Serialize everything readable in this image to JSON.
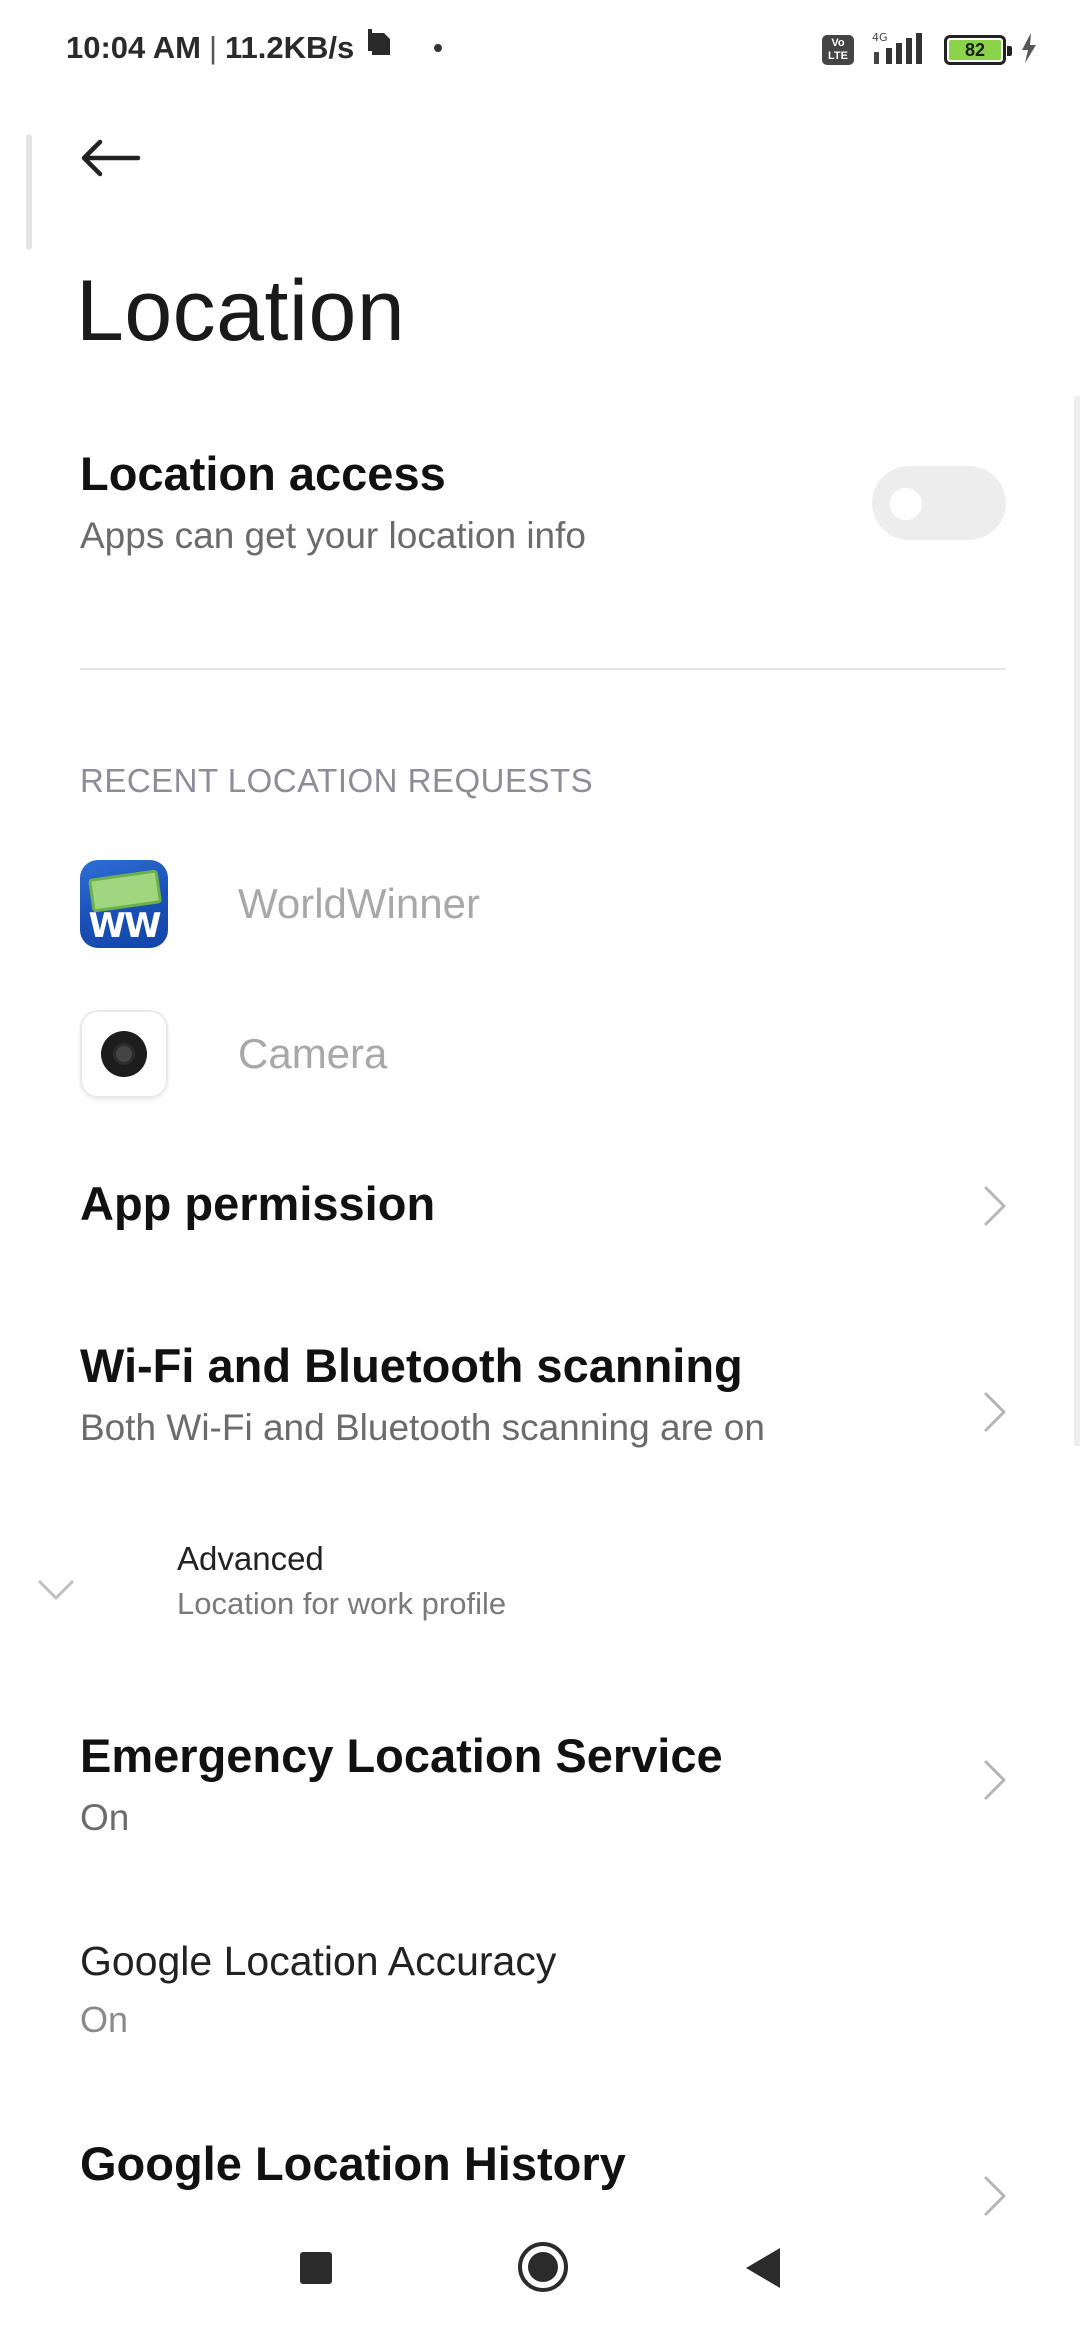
{
  "status_bar": {
    "time": "10:04 AM",
    "separator": "|",
    "network_speed": "11.2KB/s",
    "icons": [
      "sim-card-icon",
      "notification-dot-icon",
      "volte-icon",
      "signal-4g-icon",
      "battery-icon",
      "charging-icon"
    ],
    "volte_label": "Vo\nLTE",
    "network_type": "4G",
    "battery_level": "82",
    "battery_color": "#8bd34a"
  },
  "header": {
    "back_icon": "arrow-left-icon",
    "title": "Location"
  },
  "location_access": {
    "title": "Location access",
    "subtitle": "Apps can get your location info",
    "toggle_on": false
  },
  "recent_requests": {
    "header": "RECENT LOCATION REQUESTS",
    "apps": [
      {
        "name": "WorldWinner",
        "icon": "worldwinner-app-icon",
        "icon_text": "WW"
      },
      {
        "name": "Camera",
        "icon": "camera-app-icon"
      }
    ]
  },
  "settings": {
    "app_permission": {
      "title": "App permission"
    },
    "wifi_bt_scanning": {
      "title": "Wi-Fi and Bluetooth scanning",
      "subtitle": "Both Wi-Fi and Bluetooth scanning are on"
    },
    "advanced": {
      "title": "Advanced",
      "subtitle": "Location for work profile"
    },
    "emergency_service": {
      "title": "Emergency Location Service",
      "subtitle": "On"
    },
    "google_accuracy": {
      "title": "Google Location Accuracy",
      "subtitle": "On"
    },
    "google_history": {
      "title": "Google Location History"
    }
  },
  "nav_bar": {
    "buttons": [
      "recents-button",
      "home-button",
      "back-button"
    ]
  },
  "colors": {
    "accent_text": "#111111",
    "secondary_text": "#6b6b6b",
    "section_header": "#8d8d98",
    "disabled_text": "#a8a8a8"
  }
}
